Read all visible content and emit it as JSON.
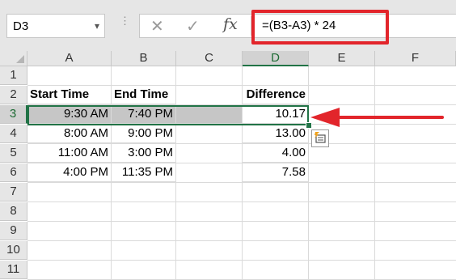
{
  "name_box": {
    "value": "D3"
  },
  "formula_bar": {
    "cancel_glyph": "✕",
    "enter_glyph": "✓",
    "fx_label": "fx",
    "formula": "=(B3-A3) * 24"
  },
  "columns": [
    "A",
    "B",
    "C",
    "D",
    "E",
    "F"
  ],
  "rows": [
    "1",
    "2",
    "3",
    "4",
    "5",
    "6",
    "7",
    "8",
    "9",
    "10",
    "11"
  ],
  "sheet": {
    "headers": {
      "start_time": "Start Time",
      "end_time": "End Time",
      "difference": "Difference"
    },
    "data": [
      {
        "start": "9:30 AM",
        "end": "7:40 PM",
        "diff": "10.17"
      },
      {
        "start": "8:00 AM",
        "end": "9:00 PM",
        "diff": "13.00"
      },
      {
        "start": "11:00 AM",
        "end": "3:00 PM",
        "diff": "4.00"
      },
      {
        "start": "4:00 PM",
        "end": "11:35 PM",
        "diff": "7.58"
      }
    ]
  },
  "colors": {
    "selection_green": "#217346",
    "annotation_red": "#e2252b",
    "highlight_gray": "#c6c6c6"
  },
  "icons": {
    "name_box_dropdown": "chevron-down-icon",
    "quick_analysis": "quick-analysis-icon",
    "annotation": "arrow-left-icon"
  }
}
